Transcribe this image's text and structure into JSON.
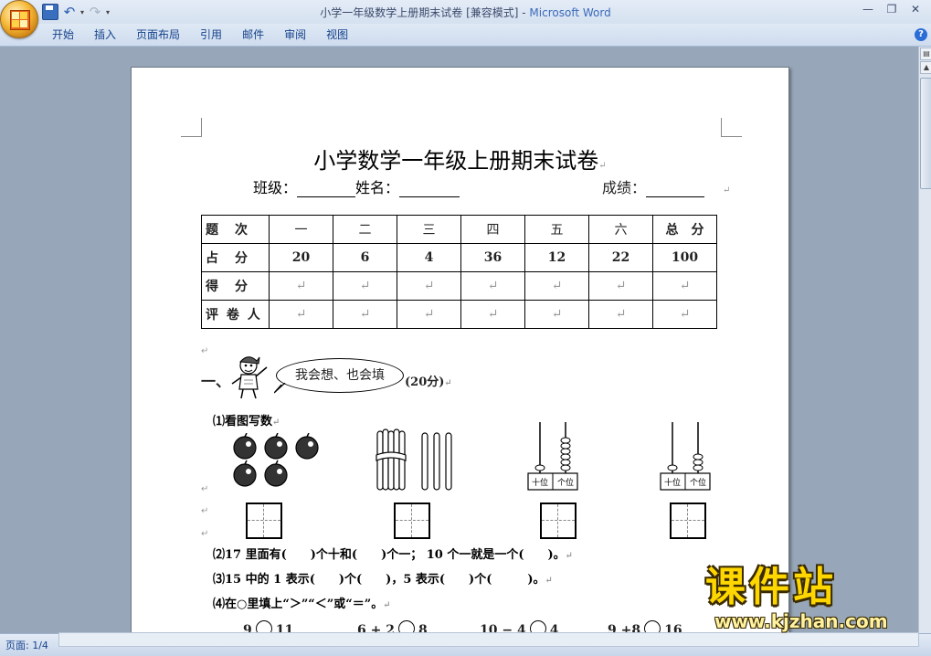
{
  "window": {
    "title": "小学一年级数学上册期末试卷 [兼容模式] - ",
    "app_name": "Microsoft Word"
  },
  "ribbon": {
    "tabs": [
      "开始",
      "插入",
      "页面布局",
      "引用",
      "邮件",
      "审阅",
      "视图"
    ]
  },
  "document": {
    "title": "小学数学一年级上册期末试卷",
    "para_mark": "↵",
    "class_label": "班级：",
    "name_label": "姓名：",
    "score_label": "成绩：",
    "table": {
      "header": [
        "题　次",
        "一",
        "二",
        "三",
        "四",
        "五",
        "六",
        "总　分"
      ],
      "row_points_label": "占　分",
      "points": [
        "20",
        "6",
        "4",
        "36",
        "12",
        "22",
        "100"
      ],
      "row_got_label": "得　分",
      "row_grader_label": "评 卷 人"
    },
    "section1": {
      "number": "一、",
      "bubble": "我会想、也会填",
      "points": "(20分)"
    },
    "q1": "⑴看图写数",
    "q2": "⑵17 里面有(　　)个十和(　　)个一； 10 个一就是一个(　　)。",
    "q3": "⑶15 中的 1 表示(　　)个(　　)，5 表示(　　)个(　　　)。",
    "q4": "⑷在○里填上“＞”“＜”或“＝”。",
    "abacus_labels": [
      "十位",
      "个位"
    ],
    "compare": [
      {
        "left": "9",
        "right": "11"
      },
      {
        "left": "6 + 2",
        "right": "8"
      },
      {
        "left": "10 − 4",
        "right": "4"
      },
      {
        "left": "9 +8",
        "right": "16"
      }
    ]
  },
  "status": {
    "page": "页面: 1/4"
  },
  "watermark": {
    "text": "课件站",
    "url": "www.kjzhan.com"
  }
}
